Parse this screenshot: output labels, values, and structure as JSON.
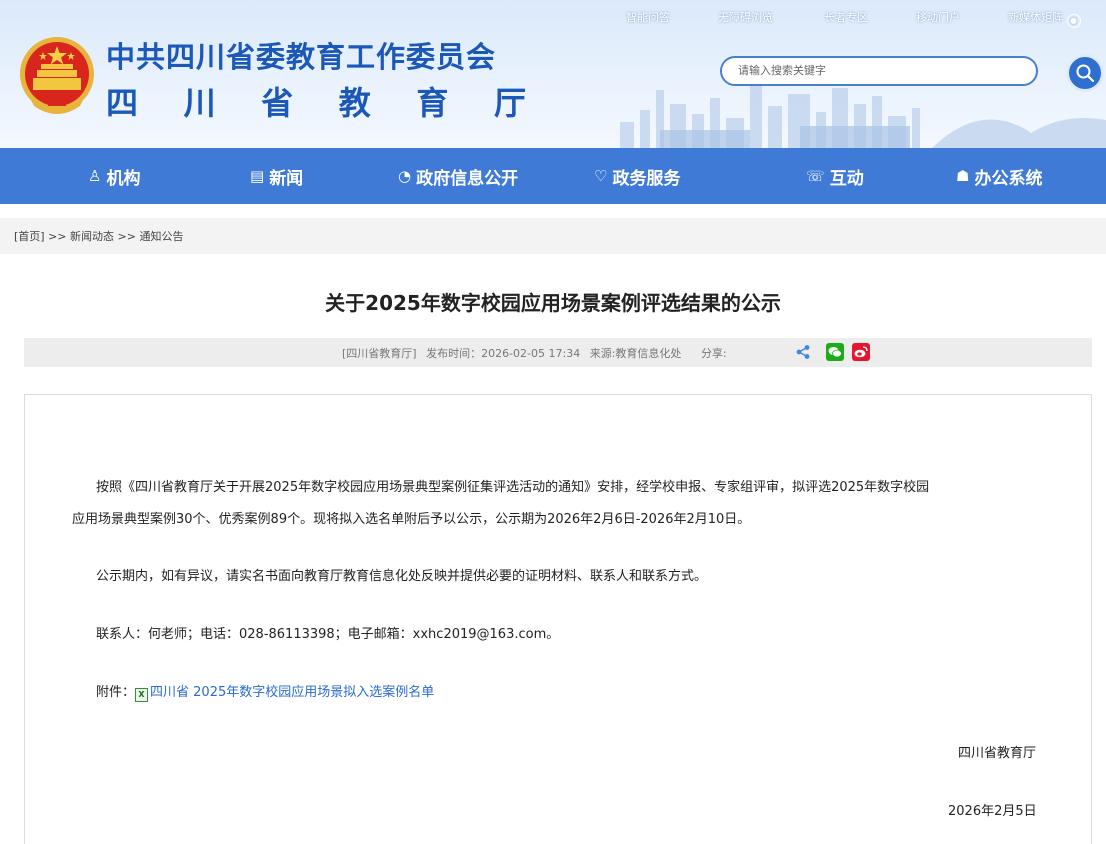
{
  "header": {
    "title_main": "中共四川省委教育工作委员会",
    "title_sub": [
      "四",
      "川",
      "省",
      "教",
      "育",
      "厅"
    ],
    "top_links": [
      "智能问答",
      "无障碍浏览",
      "长者专区",
      "移动门户",
      "新媒体矩阵"
    ],
    "search_placeholder": "请输入搜索关键字"
  },
  "nav": {
    "items": [
      {
        "label": "机构",
        "icon": "org-icon"
      },
      {
        "label": "新闻",
        "icon": "news-icon"
      },
      {
        "label": "政府信息公开",
        "icon": "gov-info-icon"
      },
      {
        "label": "政务服务",
        "icon": "service-icon"
      },
      {
        "label": "互动",
        "icon": "interact-icon"
      },
      {
        "label": "办公系统",
        "icon": "office-icon"
      }
    ]
  },
  "breadcrumb": {
    "home": "[首页]",
    "sep": ">>",
    "level1": "新闻动态",
    "level2": "通知公告"
  },
  "article": {
    "title": "关于2025年数字校园应用场景案例评选结果的公示",
    "meta_source": "[四川省教育厅]",
    "meta_time": "发布时间：2026-02-05 17:34",
    "meta_origin": "来源:教育信息化处",
    "meta_share": "分享:",
    "para1_line1": "按照《四川省教育厅关于开展2025年数字校园应用场景典型案例征集评选活动的通知》安排，经学校申报、专家组评审，拟评选2025年数字校园",
    "para1_line2": "应用场景典型案例30个、优秀案例89个。现将拟入选名单附后予以公示，公示期为2026年2月6日-2026年2月10日。",
    "para2": "公示期内，如有异议，请实名书面向教育厅教育信息化处反映并提供必要的证明材料、联系人和联系方式。",
    "para3": "联系人：何老师；电话：028-86113398；电子邮箱：xxhc2019@163.com。",
    "attach_label": "附件：",
    "attach_link": "四川省 2025年数字校园应用场景拟入选案例名单",
    "signature": "四川省教育厅",
    "date": "2026年2月5日"
  },
  "colors": {
    "brand_blue": "#1b58b8",
    "nav_blue": "#3e7ad6",
    "link_blue": "#2a6ad0",
    "wechat_green": "#1aad19",
    "weibo_red": "#e6162d"
  }
}
